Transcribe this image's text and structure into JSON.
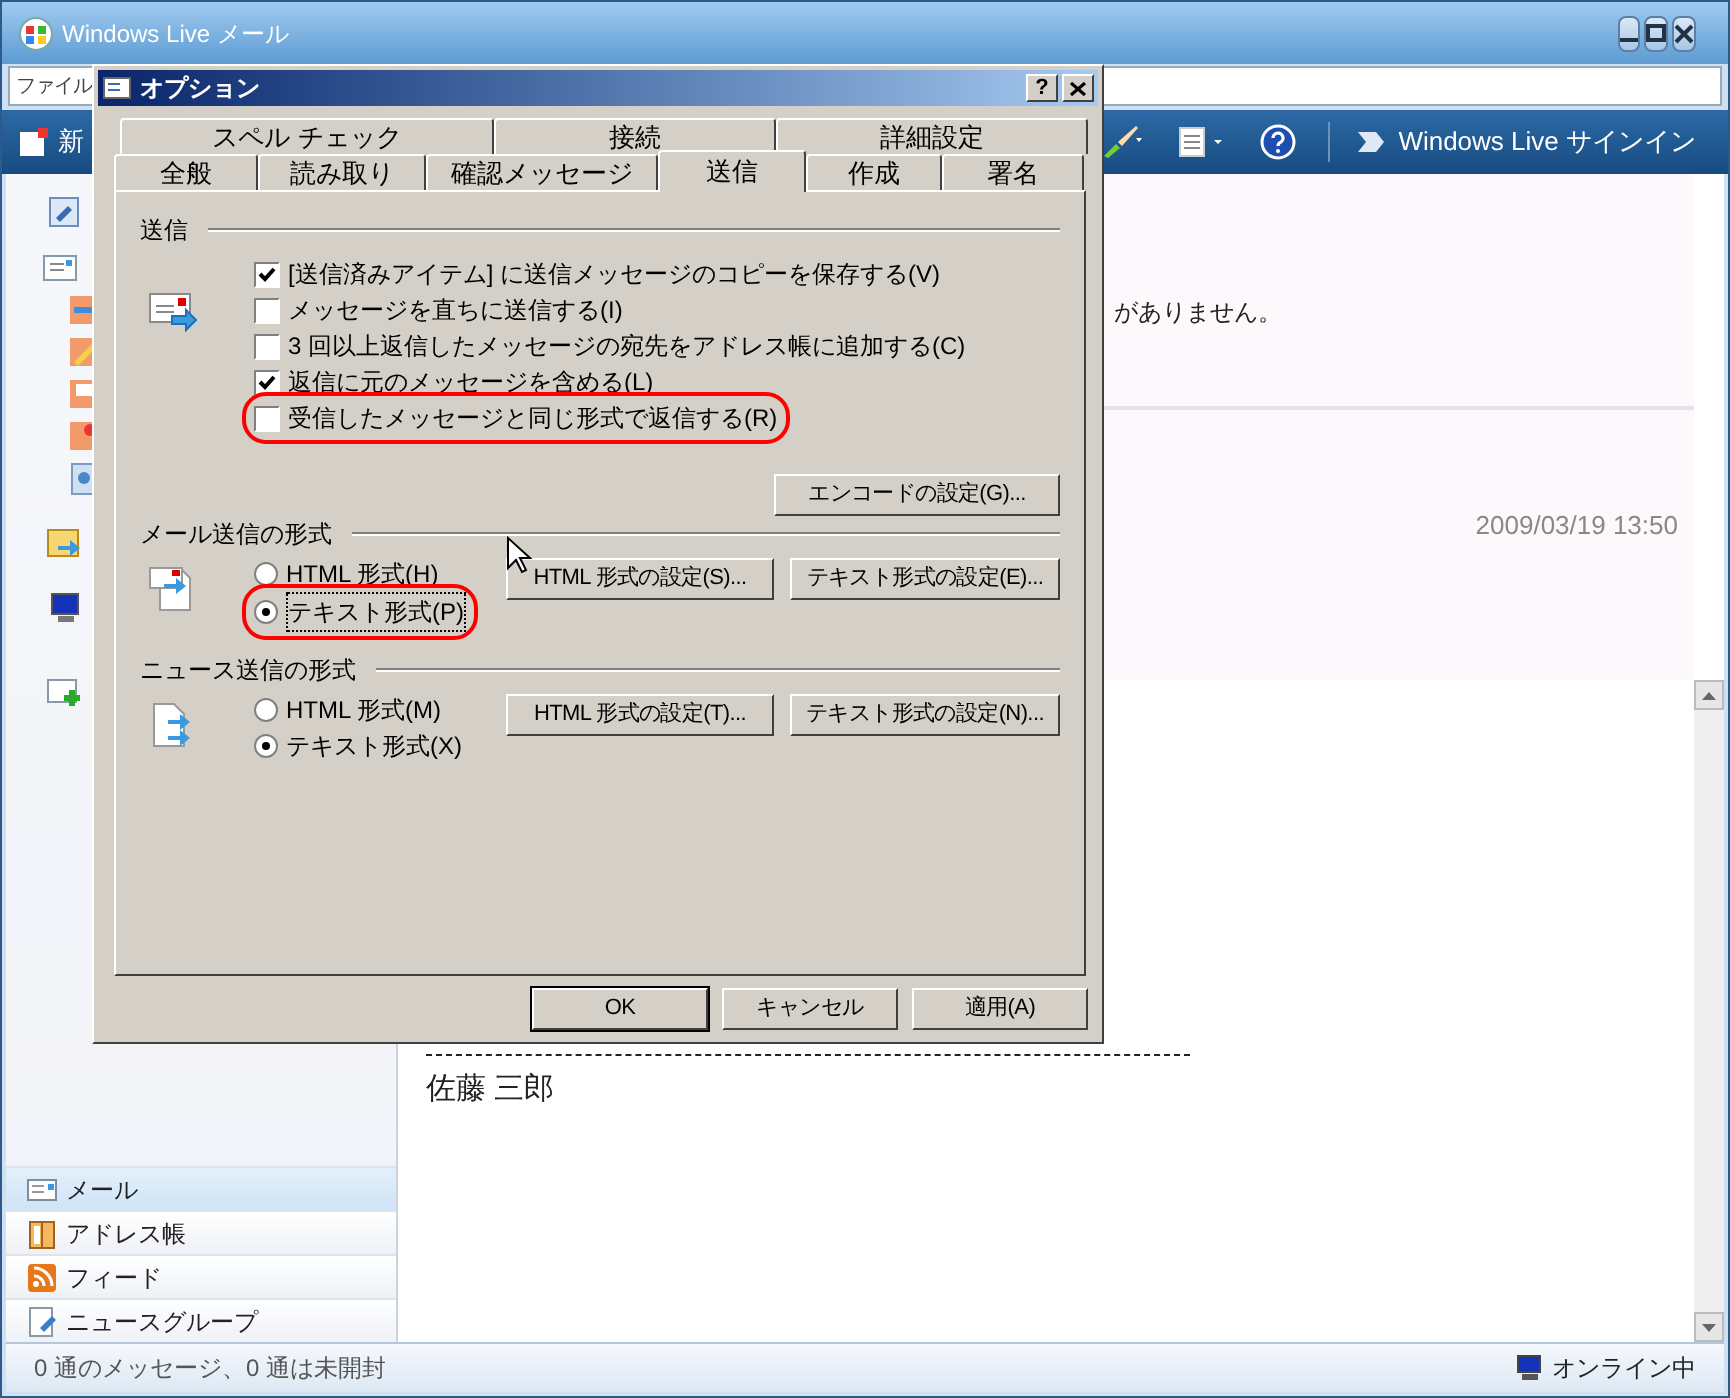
{
  "app": {
    "title": "Windows Live メール",
    "menu_visible": "ファイル",
    "toolbar": {
      "new_label": "新",
      "sign_in": "Windows Live サインイン"
    },
    "preview": {
      "notice": "がありません。",
      "date": "2009/03/19 13:50",
      "signature": "佐藤 三郎"
    },
    "sidebar_nav": [
      {
        "label": "メール",
        "selected": true,
        "kind": "mail"
      },
      {
        "label": "アドレス帳",
        "selected": false,
        "kind": "contacts"
      },
      {
        "label": "フィード",
        "selected": false,
        "kind": "feed"
      },
      {
        "label": "ニュースグループ",
        "selected": false,
        "kind": "news"
      }
    ],
    "status_bar": {
      "left": "0 通のメッセージ、0 通は未開封",
      "right": "オンライン中"
    }
  },
  "dialog": {
    "title": "オプション",
    "help": "?",
    "tab_rows": [
      [
        {
          "label": "スペル チェック",
          "selected": false
        },
        {
          "label": "接続",
          "selected": false
        },
        {
          "label": "詳細設定",
          "selected": false
        }
      ],
      [
        {
          "label": "全般",
          "selected": false
        },
        {
          "label": "読み取り",
          "selected": false
        },
        {
          "label": "確認メッセージ",
          "selected": false
        },
        {
          "label": "送信",
          "selected": true
        },
        {
          "label": "作成",
          "selected": false
        },
        {
          "label": "署名",
          "selected": false
        }
      ]
    ],
    "sections": [
      {
        "title": "送信",
        "kind": "checks",
        "items": [
          {
            "label": "[送信済みアイテム] に送信メッセージのコピーを保存する(V)",
            "checked": true,
            "highlighted": false
          },
          {
            "label": "メッセージを直ちに送信する(I)",
            "checked": false,
            "highlighted": false
          },
          {
            "label": "3 回以上返信したメッセージの宛先をアドレス帳に追加する(C)",
            "checked": false,
            "highlighted": false
          },
          {
            "label": "返信に元のメッセージを含める(L)",
            "checked": true,
            "highlighted": false
          },
          {
            "label": "受信したメッセージと同じ形式で返信する(R)",
            "checked": false,
            "highlighted": true
          }
        ],
        "buttons": [
          "エンコードの設定(G)..."
        ]
      },
      {
        "title": "メール送信の形式",
        "kind": "radios",
        "items": [
          {
            "label": "HTML 形式(H)",
            "selected": false,
            "highlighted": false
          },
          {
            "label": "テキスト形式(P)",
            "selected": true,
            "highlighted": true
          }
        ],
        "buttons": [
          "HTML 形式の設定(S)...",
          "テキスト形式の設定(E)..."
        ]
      },
      {
        "title": "ニュース送信の形式",
        "kind": "radios",
        "items": [
          {
            "label": "HTML 形式(M)",
            "selected": false,
            "highlighted": false
          },
          {
            "label": "テキスト形式(X)",
            "selected": true,
            "highlighted": false
          }
        ],
        "buttons": [
          "HTML 形式の設定(T)...",
          "テキスト形式の設定(N)..."
        ]
      }
    ],
    "buttons": [
      {
        "label": "OK",
        "default": true
      },
      {
        "label": "キャンセル",
        "default": false
      },
      {
        "label": "適用(A)",
        "default": false
      }
    ]
  }
}
